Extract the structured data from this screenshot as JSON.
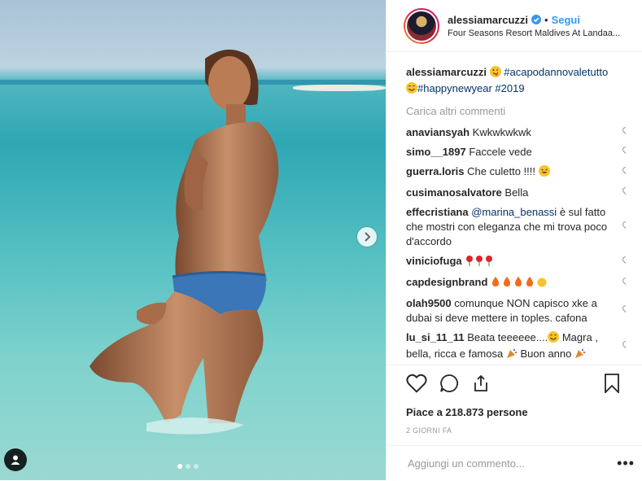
{
  "post": {
    "username": "alessiamarcuzzi",
    "follow_label": "Segui",
    "separator": "•",
    "location": "Four Seasons Resort Maldives At Landaa...",
    "caption_user": "alessiamarcuzzi",
    "caption_tag1": "#acapodannovaletutto",
    "caption_tag2": "#happynewyear",
    "caption_tag3": "#2019",
    "load_more": "Carica altri commenti",
    "likes": "Piace a 218.873 persone",
    "time": "2 GIORNI FA",
    "add_comment_placeholder": "Aggiungi un commento...",
    "more_label": "•••"
  },
  "comments": [
    {
      "user": "anaviansyah",
      "text": "Kwkwkwkwk"
    },
    {
      "user": "simo__1897",
      "text": "Faccele vede"
    },
    {
      "user": "guerra.loris",
      "text": "Che culetto !!!!"
    },
    {
      "user": "cusimanosalvatore",
      "text": "Bella"
    },
    {
      "user": "effecristiana",
      "mention": "@marina_benassi",
      "text": " è sul fatto che mostri con eleganza che mi trova poco d'accordo"
    },
    {
      "user": "viniciofuga",
      "text": ""
    },
    {
      "user": "capdesignbrand",
      "text": ""
    },
    {
      "user": "olah9500",
      "text": "comunque NON capisco xke a dubai si deve mettere in toples. cafona"
    },
    {
      "user": "lu_si_11_11",
      "text1": "Beata teeeeee....",
      "text2": " Magra , bella, ricca e famosa",
      "text3": " Buon anno"
    }
  ],
  "colors": {
    "link": "#3897f0",
    "hashtag": "#003569",
    "muted": "#999999",
    "text": "#262626"
  }
}
